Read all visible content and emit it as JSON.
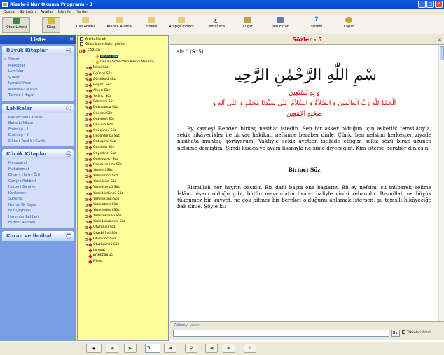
{
  "window": {
    "title": "Risale-i Nur Okuma Programı - 3"
  },
  "menu": [
    "Dosya",
    "Görünüm",
    "Ayarlar",
    "İşlemler",
    "Yardım"
  ],
  "toolbar": {
    "kitap_listesi": "Kitap Listesi",
    "kitap": "Kitap",
    "kulli_arama": "Külli Arama",
    "arapca_arama": "Arapça Arama",
    "indeks": "İndeks",
    "arapca_indeks": "Arapça İndeks",
    "osmanlica": "Osmanlıca",
    "lugat": "Lugat",
    "tam_ekran": "Tam Ekran",
    "yardim": "Yardım",
    "kapat": "Kapat"
  },
  "left": {
    "title": "Liste",
    "groups": [
      {
        "title": "Büyük Kitaplar",
        "items": [
          "Sözler",
          "Mektubat",
          "Lem'alar",
          "Şualar",
          "İşaratül İ'caz",
          "Mesnevi-i Nuriye",
          "Tarihçe-i Hayat"
        ]
      },
      {
        "title": "Lahikalar",
        "items": [
          "Kastamonu Lahikası",
          "Barla Lahikası",
          "Emirdağ - 1",
          "Emirdağ - 2",
          "Sikke-i Tasdik-i Gaybi"
        ]
      },
      {
        "title": "Küçük Kitaplar",
        "items": [
          "Münazarat",
          "Muhakemat",
          "Divan-ı Harb-i Örfi",
          "Gençlik Rehberi",
          "Hutbe-i Şamiye",
          "Konferans",
          "Sünuhat",
          "Nur'un İlk Kapısı",
          "Nur Çeşmesi",
          "Hanımlar Rehberi",
          "Hizmet Rehberi"
        ]
      },
      {
        "title": "Kuran ve İlmihal",
        "items": []
      }
    ]
  },
  "tree": {
    "opt1": "Yeri takip et",
    "opt2": "Kitap işaretlerini göster",
    "root": "SÖZLER",
    "items": [
      "Birinci Söz",
      "Önden(Sözler'den Birinci Makam)",
      "İkinci Söz",
      "Üçüncü Söz",
      "Dördüncü Söz",
      "Beşinci Söz",
      "Altıncı Söz",
      "Yedinci Söz",
      "Sekizinci Söz",
      "Dokuzuncu Söz",
      "Onuncu Söz",
      "Onbirinci Söz",
      "Onikinci Söz",
      "Onüçüncü Söz",
      "Ondördüncü Söz",
      "Onbeşinci Söz",
      "Onaltıncı Söz",
      "Onyedinci Söz",
      "Onsekizinci Söz",
      "Ondokuzuncu Söz",
      "Yirminci Söz",
      "Yirmibirinci Söz",
      "Yirmiikinci Söz",
      "Yirmiüçüncü Söz",
      "Yirmidördüncü Söz",
      "Yirmibeşinci Söz",
      "Yirmialtıncı Söz",
      "Yirmiyedinci Söz",
      "Yirmisekizinci Söz",
      "Yirmidokuzuncu Söz",
      "Otuzuncu Söz",
      "Otuzbirinci Söz",
      "Otuzikinci Söz",
      "Otuzüçüncü Söz",
      "Lemeat",
      "KONFERANS",
      "Fihrist"
    ]
  },
  "reader": {
    "title": "Sözler - 5",
    "page_label": "sh: \" (S: 5)",
    "bismillah": "بِسْمِ اللّٰهِ الرَّحْمٰنِ الرَّحِيمِ",
    "arabic1": "وَ بِهِ نَسْتَعِينُ",
    "arabic2": "اَلْحَمْدُ لِلّٰهِ رَبِّ الْعَالَمِينَ وَ الصَّلاَةُ وَ السَّلاَمُ عَلَى سَيِّدِنَا مُحَمَّدٍ وَ عَلَى آلِهِ وَ",
    "arabic3": "صَحْبِهِ اَجْمَعِينَ",
    "para1": "Ey kardeş! Benden birkaç nasihat istedin. Sen bir asker olduğun için askerlik temsilâtıyla, sekiz hikâyecikler ile birkaç hakikatı nefsimle beraber dinle. Çünki ben nefsimi herkesten ziyade nasihata muhtaç görüyorum. Vaktiyle sekiz âyetten istifade ettiğim sekiz sözü biraz uzunca nefsime demiştim. Şimdi kısaca ve avam lisanıyla nefsime diyeceğim. Kim isterse beraber dinlesin.",
    "section": "Birinci Söz",
    "para2": "Bismillah her hayrın başıdır. Biz dahi başta ona başlarız. Bil ey nefsim, şu mübarek kelime İslâm nişanı olduğu gibi, bütün mevcudatın lisan-ı haliyle vird-i zebanıdır. Bismillah ne büyük tükenmez bir kuvvet, ne çok bitmez bir bereket olduğunu anlamak istersen, şu temsili hikâyeciğe bak dinle. Şöyle ki:"
  },
  "search": {
    "label": "Kelimeyi yazın:",
    "value": "",
    "button": "Bul",
    "option": "Takkeleri ihmal"
  },
  "status": {
    "page": "5"
  },
  "colors": {
    "accent": "#215dc6",
    "tree_bg": "#ffff99",
    "arabic": "#c00000"
  }
}
